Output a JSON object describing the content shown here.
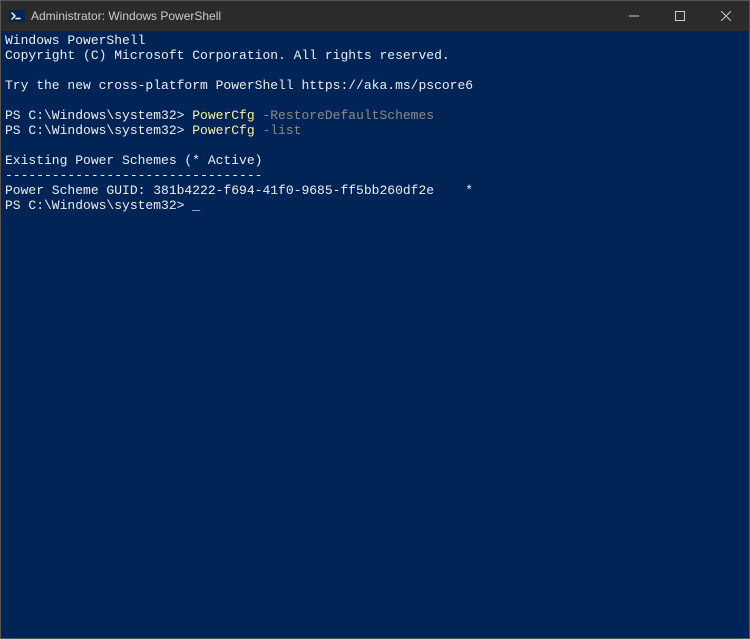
{
  "window": {
    "title": "Administrator: Windows PowerShell"
  },
  "terminal": {
    "header1": "Windows PowerShell",
    "header2": "Copyright (C) Microsoft Corporation. All rights reserved.",
    "tryNew": "Try the new cross-platform PowerShell https://aka.ms/pscore6",
    "prompt1": "PS C:\\Windows\\system32> ",
    "cmd1": "PowerCfg",
    "arg1": " -RestoreDefaultSchemes",
    "prompt2": "PS C:\\Windows\\system32> ",
    "cmd2": "PowerCfg",
    "arg2": " -list",
    "output1": "Existing Power Schemes (* Active)",
    "output2": "---------------------------------",
    "output3": "Power Scheme GUID: 381b4222-f694-41f0-9685-ff5bb260df2e    *",
    "prompt3": "PS C:\\Windows\\system32> "
  }
}
